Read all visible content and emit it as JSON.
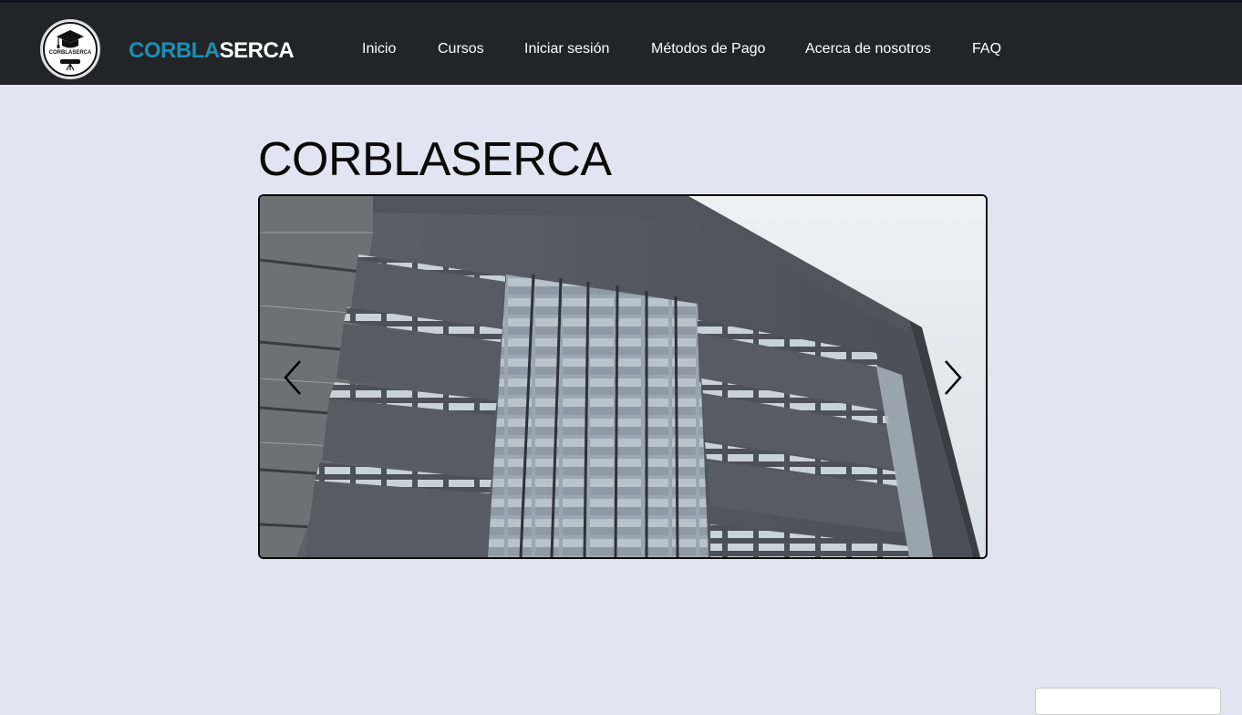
{
  "header": {
    "logo": {
      "icon": "graduation-cap-icon",
      "text": "CORBLASERCA"
    },
    "brand": {
      "part1": "CORBLA",
      "part2": "SERCA",
      "color_part1": "#1b8fb3",
      "color_part2": "#ffffff"
    },
    "nav": [
      {
        "label": "Inicio"
      },
      {
        "label": "Cursos"
      },
      {
        "label": "Iniciar sesión"
      },
      {
        "label": "Métodos de Pago"
      },
      {
        "label": "Acerca de nosotros"
      },
      {
        "label": "FAQ"
      }
    ]
  },
  "main": {
    "title": "CORBLASERCA",
    "carousel": {
      "slide_image": "modern-building-facade-photo",
      "prev_icon": "chevron-left-icon",
      "next_icon": "chevron-right-icon"
    }
  },
  "colors": {
    "topbar": "#232427",
    "page_background": "#e3e4f2",
    "accent": "#1b8fb3"
  }
}
